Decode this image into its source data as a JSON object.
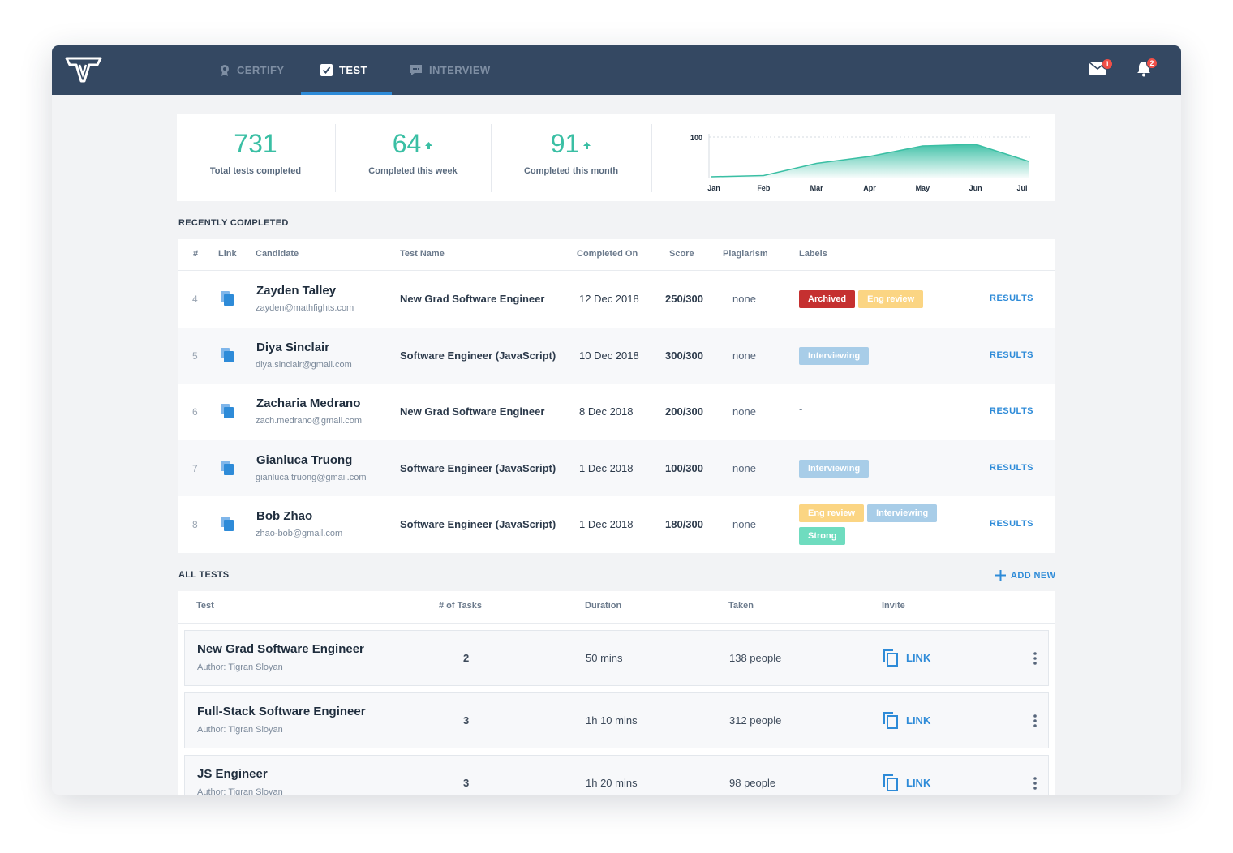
{
  "nav": {
    "tabs": [
      {
        "label": "CERTIFY",
        "icon": "award-icon",
        "active": false
      },
      {
        "label": "TEST",
        "icon": "checkbox-icon",
        "active": true
      },
      {
        "label": "INTERVIEW",
        "icon": "chat-icon",
        "active": false
      }
    ],
    "mail_badge": "1",
    "bell_badge": "2"
  },
  "stats": [
    {
      "value": "731",
      "label": "Total tests completed",
      "trend": "none"
    },
    {
      "value": "64",
      "label": "Completed this week",
      "trend": "up"
    },
    {
      "value": "91",
      "label": "Completed this month",
      "trend": "up"
    }
  ],
  "chart_data": {
    "type": "area",
    "categories": [
      "Jan",
      "Feb",
      "Mar",
      "Apr",
      "May",
      "Jun",
      "Jul"
    ],
    "values": [
      2,
      5,
      35,
      52,
      78,
      82,
      40
    ],
    "ytick_label": "100",
    "ylim": [
      0,
      100
    ],
    "grid": false,
    "color": "#3abfa4"
  },
  "recent": {
    "title": "RECENTLY COMPLETED",
    "headers": {
      "num": "#",
      "link": "Link",
      "candidate": "Candidate",
      "test": "Test Name",
      "completed": "Completed On",
      "score": "Score",
      "plagiarism": "Plagiarism",
      "labels": "Labels"
    },
    "rows": [
      {
        "num": "4",
        "name": "Zayden Talley",
        "email": "zayden@mathfights.com",
        "test": "New Grad Software Engineer",
        "date": "12 Dec 2018",
        "score": "250/300",
        "plagiarism": "none",
        "labels": [
          {
            "text": "Archived",
            "kind": "archived"
          },
          {
            "text": "Eng review",
            "kind": "eng"
          }
        ],
        "empty_label": "",
        "action": "RESULTS"
      },
      {
        "num": "5",
        "name": "Diya Sinclair",
        "email": "diya.sinclair@gmail.com",
        "test": "Software Engineer (JavaScript)",
        "date": "10 Dec 2018",
        "score": "300/300",
        "plagiarism": "none",
        "labels": [
          {
            "text": "Interviewing",
            "kind": "interviewing"
          }
        ],
        "empty_label": "",
        "action": "RESULTS"
      },
      {
        "num": "6",
        "name": "Zacharia Medrano",
        "email": "zach.medrano@gmail.com",
        "test": "New Grad Software Engineer",
        "date": "8 Dec 2018",
        "score": "200/300",
        "plagiarism": "none",
        "labels": [],
        "empty_label": "-",
        "action": "RESULTS"
      },
      {
        "num": "7",
        "name": "Gianluca Truong",
        "email": "gianluca.truong@gmail.com",
        "test": "Software Engineer (JavaScript)",
        "date": "1 Dec 2018",
        "score": "100/300",
        "plagiarism": "none",
        "labels": [
          {
            "text": "Interviewing",
            "kind": "interviewing"
          }
        ],
        "empty_label": "",
        "action": "RESULTS"
      },
      {
        "num": "8",
        "name": "Bob Zhao",
        "email": "zhao-bob@gmail.com",
        "test": "Software Engineer (JavaScript)",
        "date": "1 Dec 2018",
        "score": "180/300",
        "plagiarism": "none",
        "labels": [
          {
            "text": "Eng review",
            "kind": "eng"
          },
          {
            "text": "Interviewing",
            "kind": "interviewing"
          },
          {
            "text": "Strong",
            "kind": "strong"
          }
        ],
        "empty_label": "",
        "action": "RESULTS"
      }
    ]
  },
  "all_tests": {
    "title": "ALL TESTS",
    "add_new": "ADD NEW",
    "headers": {
      "test": "Test",
      "tasks": "# of Tasks",
      "duration": "Duration",
      "taken": "Taken",
      "invite": "Invite"
    },
    "rows": [
      {
        "name": "New Grad Software Engineer",
        "author": "Author: Tigran Sloyan",
        "tasks": "2",
        "duration": "50 mins",
        "taken": "138 people",
        "invite": "LINK"
      },
      {
        "name": "Full-Stack Software Engineer",
        "author": "Author: Tigran Sloyan",
        "tasks": "3",
        "duration": "1h 10 mins",
        "taken": "312 people",
        "invite": "LINK"
      },
      {
        "name": "JS Engineer",
        "author": "Author: Tigran Sloyan",
        "tasks": "3",
        "duration": "1h 20 mins",
        "taken": "98 people",
        "invite": "LINK"
      }
    ]
  }
}
